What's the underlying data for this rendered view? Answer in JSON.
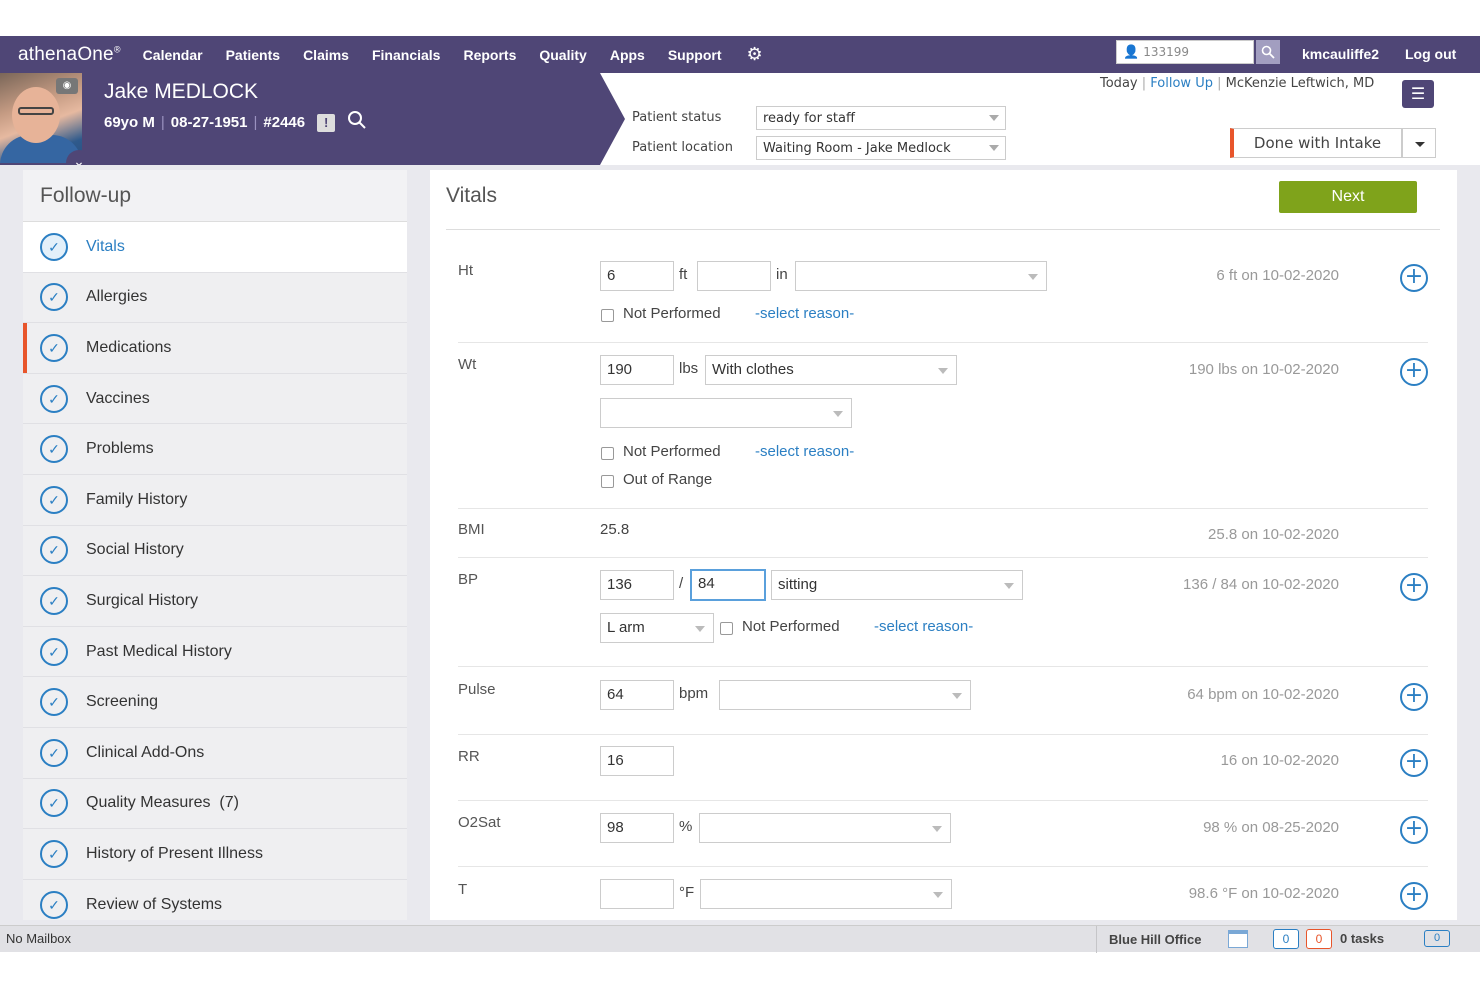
{
  "app": {
    "logo": "athenaOne",
    "logo_mark": "®"
  },
  "nav": {
    "items": [
      "Calendar",
      "Patients",
      "Claims",
      "Financials",
      "Reports",
      "Quality",
      "Apps",
      "Support"
    ],
    "search_value": "133199",
    "username": "kmcauliffe2",
    "logout": "Log out"
  },
  "patient": {
    "name": "Jake MEDLOCK",
    "age_sex": "69yo M",
    "dob": "08-27-1951",
    "id": "#2446",
    "status_label": "Patient status",
    "status_value": "ready for staff",
    "location_label": "Patient location",
    "location_value": "Waiting Room - Jake Medlock"
  },
  "context": {
    "today": "Today",
    "followup": "Follow Up",
    "provider": "McKenzie Leftwich, MD"
  },
  "done_button": "Done with Intake",
  "sidebar": {
    "title": "Follow-up",
    "items": [
      "Vitals",
      "Allergies",
      "Medications",
      "Vaccines",
      "Problems",
      "Family History",
      "Social History",
      "Surgical History",
      "Past Medical History",
      "Screening",
      "Clinical Add-Ons",
      "Quality Measures  (7)",
      "History of Present Illness",
      "Review of Systems"
    ],
    "active_index": 0,
    "marked_index": 2
  },
  "main": {
    "title": "Vitals",
    "next": "Next"
  },
  "vitals": {
    "not_performed": "Not Performed",
    "select_reason": "-select reason-",
    "out_of_range": "Out of Range",
    "ht": {
      "label": "Ht",
      "ft": "6",
      "ft_unit": "ft",
      "in": "",
      "in_unit": "in",
      "hist": "6 ft on 10-02-2020"
    },
    "wt": {
      "label": "Wt",
      "value": "190",
      "unit": "lbs",
      "clothing": "With clothes",
      "hist": "190 lbs on 10-02-2020"
    },
    "bmi": {
      "label": "BMI",
      "value": "25.8",
      "hist": "25.8 on 10-02-2020"
    },
    "bp": {
      "label": "BP",
      "systolic": "136",
      "slash": "/",
      "diastolic": "84",
      "position": "sitting",
      "site": "L arm",
      "hist": "136 / 84 on 10-02-2020"
    },
    "pulse": {
      "label": "Pulse",
      "value": "64",
      "unit": "bpm",
      "hist": "64 bpm on 10-02-2020"
    },
    "rr": {
      "label": "RR",
      "value": "16",
      "hist": "16 on 10-02-2020"
    },
    "o2": {
      "label": "O2Sat",
      "value": "98",
      "unit": "%",
      "hist": "98 % on 08-25-2020"
    },
    "temp": {
      "label": "T",
      "value": "",
      "unit": "°F",
      "hist": "98.6 °F on 10-02-2020"
    }
  },
  "footer": {
    "mailbox": "No Mailbox",
    "office": "Blue Hill Office",
    "count_blue": "0",
    "count_orange": "0",
    "tasks": "0 tasks",
    "chat_count": "0"
  },
  "colors": {
    "nav": "#4f4676",
    "accent_blue": "#2b7fc3",
    "next_green": "#7fa31b",
    "orange": "#e8552b"
  }
}
